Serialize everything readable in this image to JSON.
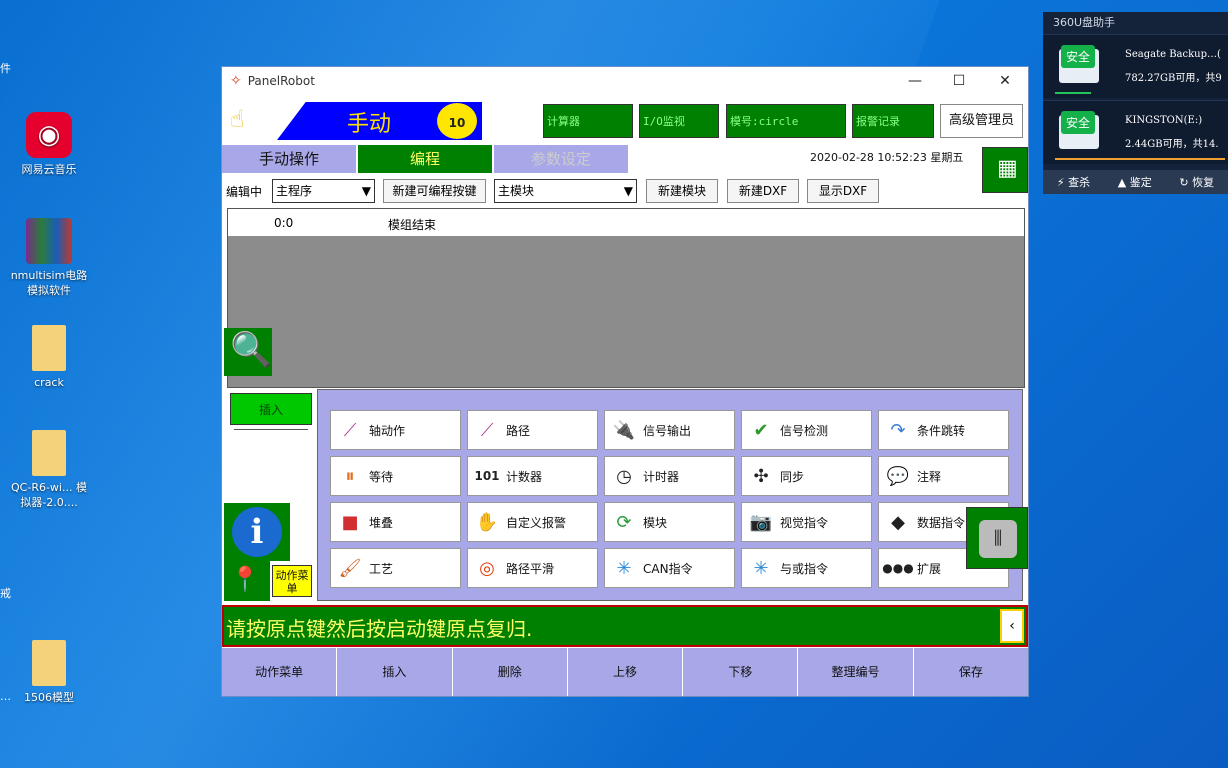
{
  "desktop": {
    "icons": [
      {
        "label": "网易云音乐"
      },
      {
        "label": "nmultisim电路模拟软件"
      },
      {
        "label": "crack"
      },
      {
        "label": "QC-R6-wi... 模拟器-2.0...."
      },
      {
        "label": "1506模型"
      }
    ],
    "edge_labels": [
      "件",
      "戒",
      "…"
    ]
  },
  "panel360": {
    "title": "360U盘助手",
    "drives": [
      {
        "safe": "安全",
        "name": "Seagate Backup…(",
        "size": "782.27GB可用，共9"
      },
      {
        "safe": "安全",
        "name": "KINGSTON(E:)",
        "size": "2.44GB可用，共14."
      }
    ],
    "tools": [
      "查杀",
      "鉴定",
      "恢复"
    ]
  },
  "window": {
    "title": "PanelRobot",
    "controls": {
      "min": "—",
      "max": "☐",
      "close": "✕"
    },
    "mode_label": "手动",
    "speed": "10",
    "top_buttons": [
      "计算器",
      "I/O监视",
      "模号:circle",
      "报警记录"
    ],
    "admin": "高级管理员",
    "tabs": [
      "手动操作",
      "编程",
      "参数设定"
    ],
    "datetime": "2020-02-28  10:52:23  星期五",
    "editing_label": "编辑中",
    "program_select": "主程序",
    "new_key_btn": "新建可编程按键",
    "module_select": "主模块",
    "new_module_btn": "新建模块",
    "new_dxf_btn": "新建DXF",
    "show_dxf_btn": "显示DXF",
    "list_rows": [
      {
        "pos": "0:0",
        "text": "模组结束"
      }
    ],
    "insert_label": "插入",
    "commands": [
      [
        "轴动作",
        "路径",
        "信号输出",
        "信号检测",
        "条件跳转"
      ],
      [
        "等待",
        "计数器",
        "计时器",
        "同步",
        "注释"
      ],
      [
        "堆叠",
        "自定义报警",
        "模块",
        "视觉指令",
        "数据指令"
      ],
      [
        "工艺",
        "路径平滑",
        "CAN指令",
        "与或指令",
        "扩展"
      ]
    ],
    "action_menu_label": "动作菜单",
    "status_msg": "请按原点键然后按启动键原点复归.",
    "bottom_buttons": [
      "动作菜单",
      "插入",
      "删除",
      "上移",
      "下移",
      "整理编号",
      "保存"
    ]
  },
  "colors": {
    "green": "#008000",
    "blue": "#0000ff",
    "lavender": "#a8a8e8",
    "yellow": "#ffff66"
  }
}
